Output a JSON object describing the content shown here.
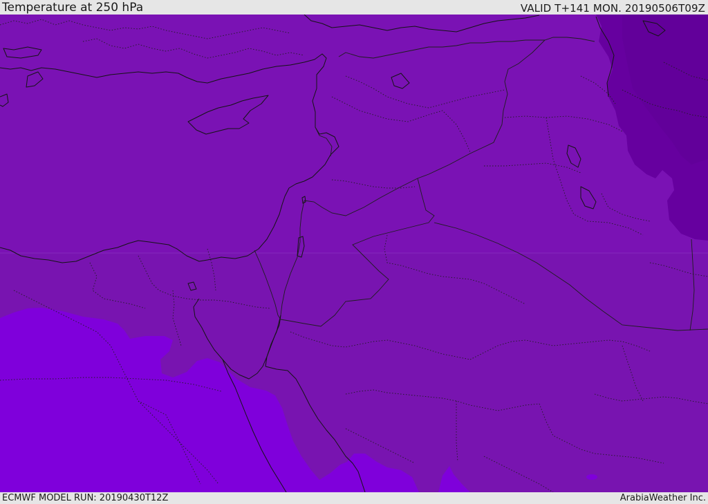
{
  "header": {
    "title": "Temperature at 250 hPa",
    "valid_time": "VALID T+141 MON. 20190506T09Z"
  },
  "footer": {
    "model_run": "ECMWF MODEL RUN: 20190430T12Z",
    "credit": "ArabiaWeather Inc."
  },
  "map": {
    "colors": {
      "base_fill": "#7a12b4",
      "warm_fill": "#7f00db",
      "cold_fill": "#66009f",
      "coastline": "#141414",
      "border": "#1e1e1e"
    }
  }
}
